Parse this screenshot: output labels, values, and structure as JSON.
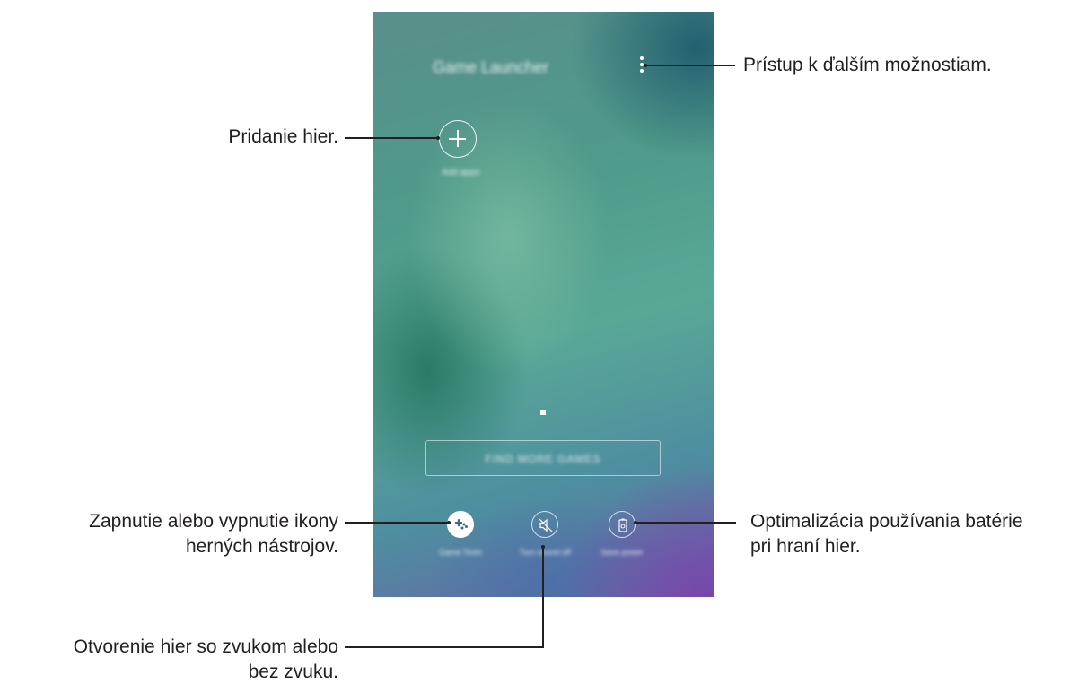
{
  "phone": {
    "title": "Game Launcher",
    "add_label": "Add apps",
    "find_button": "FIND MORE GAMES",
    "bottom_items": [
      {
        "label": "Game Tools",
        "icon": "game-tools-icon"
      },
      {
        "label": "Turn sound off",
        "icon": "mute-icon"
      },
      {
        "label": "Save power",
        "icon": "battery-settings-icon"
      }
    ]
  },
  "callouts": {
    "more_options": "Prístup k ďalším možnostiam.",
    "add_games": "Pridanie hier.",
    "game_tools_line1": "Zapnutie alebo vypnutie ikony",
    "game_tools_line2": "herných nástrojov.",
    "battery_line1": "Optimalizácia používania batérie",
    "battery_line2": "pri hraní hier.",
    "sound_line1": "Otvorenie hier so zvukom alebo",
    "sound_line2": "bez zvuku."
  }
}
